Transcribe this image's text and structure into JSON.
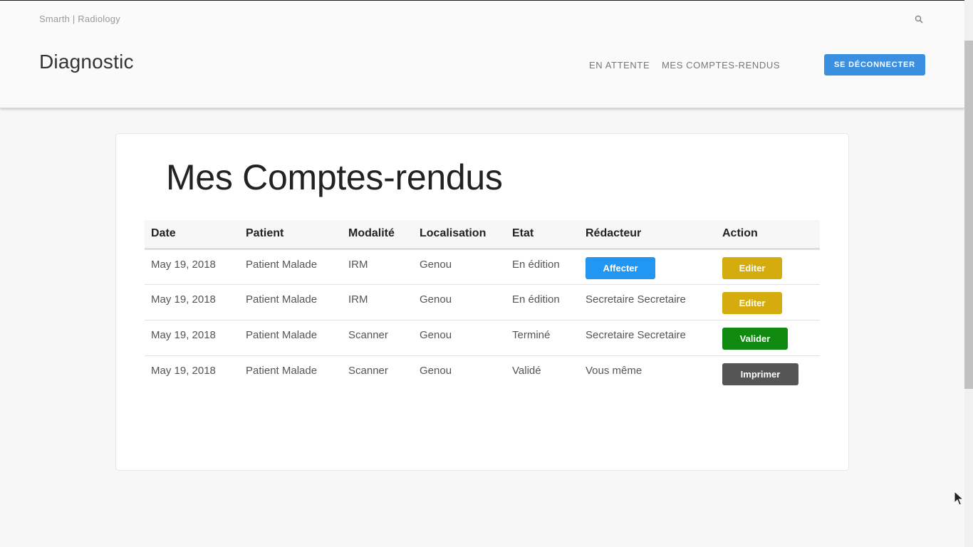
{
  "header": {
    "brand": "Smarth | Radiology",
    "site_title": "Diagnostic",
    "nav": [
      {
        "label": "EN ATTENTE"
      },
      {
        "label": "MES COMPTES-RENDUS"
      }
    ],
    "logout_label": "SE DÉCONNECTER",
    "search_icon": "search-icon"
  },
  "main": {
    "heading": "Mes Comptes-rendus",
    "columns": [
      "Date",
      "Patient",
      "Modalité",
      "Localisation",
      "Etat",
      "Rédacteur",
      "Action"
    ],
    "rows": [
      {
        "date": "May 19, 2018",
        "patient": "Patient Malade",
        "modalite": "IRM",
        "localisation": "Genou",
        "etat": "En édition",
        "redacteur": "Affecter",
        "redacteur_is_button": true,
        "action": "Editer",
        "action_color": "#d4ac0d"
      },
      {
        "date": "May 19, 2018",
        "patient": "Patient Malade",
        "modalite": "IRM",
        "localisation": "Genou",
        "etat": "En édition",
        "redacteur": "Secretaire Secretaire",
        "action": "Editer",
        "action_color": "#d4ac0d"
      },
      {
        "date": "May 19, 2018",
        "patient": "Patient Malade",
        "modalite": "Scanner",
        "localisation": "Genou",
        "etat": "Terminé",
        "redacteur": "Secretaire Secretaire",
        "action": "Valider",
        "action_color": "#108a10"
      },
      {
        "date": "May 19, 2018",
        "patient": "Patient Malade",
        "modalite": "Scanner",
        "localisation": "Genou",
        "etat": "Validé",
        "redacteur": "Vous même",
        "action": "Imprimer",
        "action_color": "#555555"
      }
    ]
  },
  "colors": {
    "primary": "#3a8fe0",
    "affecter": "#2196f3",
    "editer": "#d4ac0d",
    "valider": "#108a10",
    "imprimer": "#555555"
  }
}
